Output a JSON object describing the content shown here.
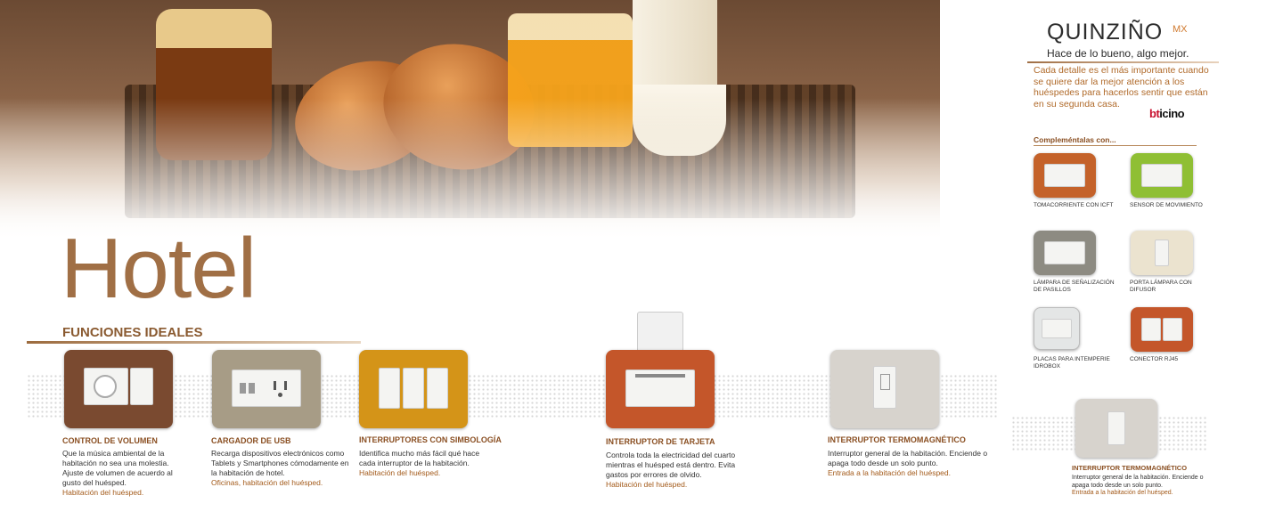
{
  "page": {
    "title": "Hotel",
    "section_title": "FUNCIONES IDEALES"
  },
  "brand": {
    "name": "QUINZIÑO",
    "suffix": "MX",
    "slogan": "Hace de lo bueno, algo mejor.",
    "intro": "Cada detalle es el más importante cuando se quiere dar la mejor atención a los huéspedes para hacerlos sentir que están en su segunda casa.",
    "logo_prefix": "bt",
    "logo_rest": "icino"
  },
  "complements": {
    "title": "Compleméntalas con...",
    "items": [
      {
        "label": "TOMACORRIENTE CON ICFT",
        "color": "#c4622a"
      },
      {
        "label": "SENSOR DE MOVIMIENTO",
        "color": "#8fbf34"
      },
      {
        "label": "LÁMPARA DE SEÑALIZACIÓN DE PASILLOS",
        "color": "#8d8b82"
      },
      {
        "label": "PORTA LÁMPARA CON DIFUSOR",
        "color": "#ebe3cf"
      },
      {
        "label": "PLACAS PARA INTEMPERIE IDROBOX",
        "color": "#e4e6e6"
      },
      {
        "label": "CONECTOR RJ45",
        "color": "#c4562a"
      }
    ]
  },
  "functions": [
    {
      "label": "CONTROL DE VOLUMEN",
      "desc": "Que la música ambiental de la habitación no sea una molestia. Ajuste de volumen de acuerdo al gusto del huésped.",
      "accent": "Habitación del huésped.",
      "color": "#7a4a30"
    },
    {
      "label": "CARGADOR DE USB",
      "desc": "Recarga dispositivos electrónicos como Tablets y Smartphones cómodamente en la habitación de hotel.",
      "accent": "Oficinas, habitación del huésped.",
      "color": "#a79c86"
    },
    {
      "label": "INTERRUPTORES CON SIMBOLOGÍA",
      "desc": "Identifica mucho más fácil qué hace cada interruptor de la habitación.",
      "accent": "Habitación del huésped.",
      "color": "#d49418"
    },
    {
      "label": "INTERRUPTOR DE TARJETA",
      "desc": "Controla toda la electricidad del cuarto mientras el huésped está dentro. Evita gastos por errores de olvido.",
      "accent": "Habitación del huésped.",
      "color": "#c4562a"
    },
    {
      "label": "INTERRUPTOR TERMOMAGNÉTICO",
      "desc": "Interruptor general de la habitación. Enciende o apaga todo desde un solo punto.",
      "accent": "Entrada a la habitación del huésped.",
      "color": "#d7d3cd"
    }
  ],
  "side_feature": {
    "label": "INTERRUPTOR TERMOMAGNÉTICO",
    "desc": "Interruptor general de la habitación. Enciende o apaga todo desde un solo punto.",
    "accent": "Entrada a la habitación del huésped.",
    "color": "#d7d3cd"
  }
}
